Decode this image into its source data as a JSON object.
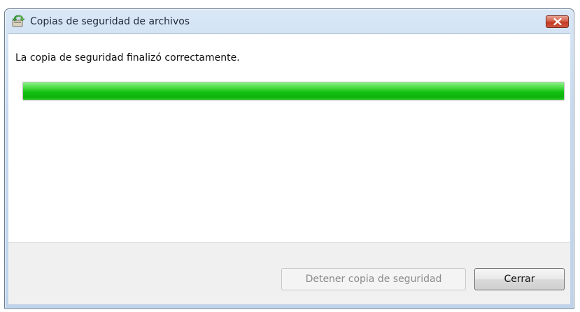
{
  "window": {
    "title": "Copias de seguridad de archivos",
    "app_icon": "backup-files-icon",
    "close_icon": "close-icon"
  },
  "content": {
    "status": "La copia de seguridad finalizó correctamente.",
    "progress_percent": 100,
    "progress_color": "#14c212"
  },
  "footer": {
    "stop_label": "Detener copia de seguridad",
    "stop_enabled": false,
    "close_label": "Cerrar"
  }
}
